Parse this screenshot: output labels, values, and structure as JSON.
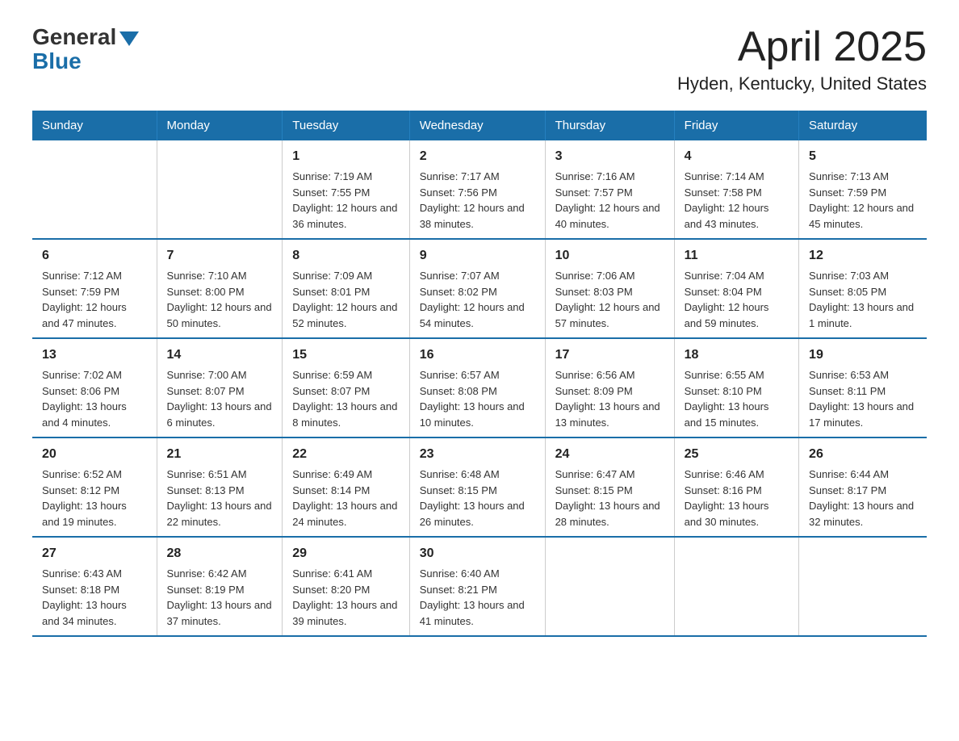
{
  "logo": {
    "general": "General",
    "blue": "Blue"
  },
  "title": "April 2025",
  "subtitle": "Hyden, Kentucky, United States",
  "days_header": [
    "Sunday",
    "Monday",
    "Tuesday",
    "Wednesday",
    "Thursday",
    "Friday",
    "Saturday"
  ],
  "weeks": [
    [
      {
        "day": "",
        "info": ""
      },
      {
        "day": "",
        "info": ""
      },
      {
        "day": "1",
        "info": "Sunrise: 7:19 AM\nSunset: 7:55 PM\nDaylight: 12 hours and 36 minutes."
      },
      {
        "day": "2",
        "info": "Sunrise: 7:17 AM\nSunset: 7:56 PM\nDaylight: 12 hours and 38 minutes."
      },
      {
        "day": "3",
        "info": "Sunrise: 7:16 AM\nSunset: 7:57 PM\nDaylight: 12 hours and 40 minutes."
      },
      {
        "day": "4",
        "info": "Sunrise: 7:14 AM\nSunset: 7:58 PM\nDaylight: 12 hours and 43 minutes."
      },
      {
        "day": "5",
        "info": "Sunrise: 7:13 AM\nSunset: 7:59 PM\nDaylight: 12 hours and 45 minutes."
      }
    ],
    [
      {
        "day": "6",
        "info": "Sunrise: 7:12 AM\nSunset: 7:59 PM\nDaylight: 12 hours and 47 minutes."
      },
      {
        "day": "7",
        "info": "Sunrise: 7:10 AM\nSunset: 8:00 PM\nDaylight: 12 hours and 50 minutes."
      },
      {
        "day": "8",
        "info": "Sunrise: 7:09 AM\nSunset: 8:01 PM\nDaylight: 12 hours and 52 minutes."
      },
      {
        "day": "9",
        "info": "Sunrise: 7:07 AM\nSunset: 8:02 PM\nDaylight: 12 hours and 54 minutes."
      },
      {
        "day": "10",
        "info": "Sunrise: 7:06 AM\nSunset: 8:03 PM\nDaylight: 12 hours and 57 minutes."
      },
      {
        "day": "11",
        "info": "Sunrise: 7:04 AM\nSunset: 8:04 PM\nDaylight: 12 hours and 59 minutes."
      },
      {
        "day": "12",
        "info": "Sunrise: 7:03 AM\nSunset: 8:05 PM\nDaylight: 13 hours and 1 minute."
      }
    ],
    [
      {
        "day": "13",
        "info": "Sunrise: 7:02 AM\nSunset: 8:06 PM\nDaylight: 13 hours and 4 minutes."
      },
      {
        "day": "14",
        "info": "Sunrise: 7:00 AM\nSunset: 8:07 PM\nDaylight: 13 hours and 6 minutes."
      },
      {
        "day": "15",
        "info": "Sunrise: 6:59 AM\nSunset: 8:07 PM\nDaylight: 13 hours and 8 minutes."
      },
      {
        "day": "16",
        "info": "Sunrise: 6:57 AM\nSunset: 8:08 PM\nDaylight: 13 hours and 10 minutes."
      },
      {
        "day": "17",
        "info": "Sunrise: 6:56 AM\nSunset: 8:09 PM\nDaylight: 13 hours and 13 minutes."
      },
      {
        "day": "18",
        "info": "Sunrise: 6:55 AM\nSunset: 8:10 PM\nDaylight: 13 hours and 15 minutes."
      },
      {
        "day": "19",
        "info": "Sunrise: 6:53 AM\nSunset: 8:11 PM\nDaylight: 13 hours and 17 minutes."
      }
    ],
    [
      {
        "day": "20",
        "info": "Sunrise: 6:52 AM\nSunset: 8:12 PM\nDaylight: 13 hours and 19 minutes."
      },
      {
        "day": "21",
        "info": "Sunrise: 6:51 AM\nSunset: 8:13 PM\nDaylight: 13 hours and 22 minutes."
      },
      {
        "day": "22",
        "info": "Sunrise: 6:49 AM\nSunset: 8:14 PM\nDaylight: 13 hours and 24 minutes."
      },
      {
        "day": "23",
        "info": "Sunrise: 6:48 AM\nSunset: 8:15 PM\nDaylight: 13 hours and 26 minutes."
      },
      {
        "day": "24",
        "info": "Sunrise: 6:47 AM\nSunset: 8:15 PM\nDaylight: 13 hours and 28 minutes."
      },
      {
        "day": "25",
        "info": "Sunrise: 6:46 AM\nSunset: 8:16 PM\nDaylight: 13 hours and 30 minutes."
      },
      {
        "day": "26",
        "info": "Sunrise: 6:44 AM\nSunset: 8:17 PM\nDaylight: 13 hours and 32 minutes."
      }
    ],
    [
      {
        "day": "27",
        "info": "Sunrise: 6:43 AM\nSunset: 8:18 PM\nDaylight: 13 hours and 34 minutes."
      },
      {
        "day": "28",
        "info": "Sunrise: 6:42 AM\nSunset: 8:19 PM\nDaylight: 13 hours and 37 minutes."
      },
      {
        "day": "29",
        "info": "Sunrise: 6:41 AM\nSunset: 8:20 PM\nDaylight: 13 hours and 39 minutes."
      },
      {
        "day": "30",
        "info": "Sunrise: 6:40 AM\nSunset: 8:21 PM\nDaylight: 13 hours and 41 minutes."
      },
      {
        "day": "",
        "info": ""
      },
      {
        "day": "",
        "info": ""
      },
      {
        "day": "",
        "info": ""
      }
    ]
  ]
}
